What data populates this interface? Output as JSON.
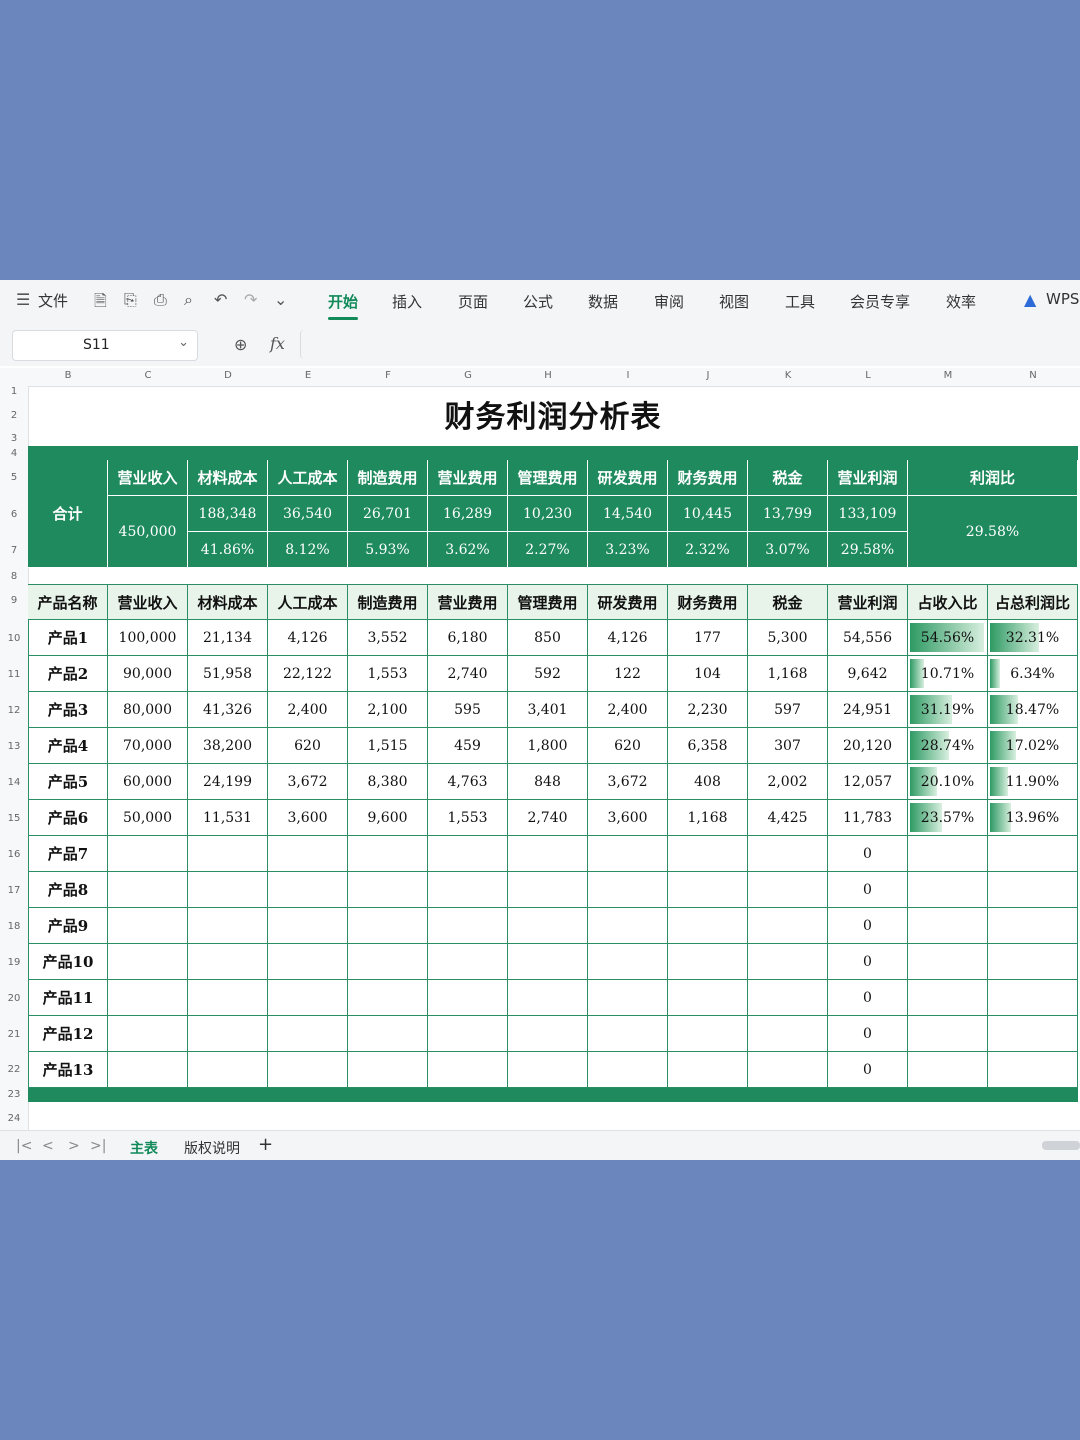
{
  "toolbar": {
    "file_label": "文件",
    "tabs": [
      "开始",
      "插入",
      "页面",
      "公式",
      "数据",
      "审阅",
      "视图",
      "工具",
      "会员专享",
      "效率"
    ],
    "active_tab": "开始",
    "brand": "WPS"
  },
  "formula_bar": {
    "cell_ref": "S11",
    "fx_label": "fx",
    "value": ""
  },
  "columns": [
    "B",
    "C",
    "D",
    "E",
    "F",
    "G",
    "H",
    "I",
    "J",
    "K",
    "L",
    "M",
    "N"
  ],
  "rows": [
    "1",
    "2",
    "3",
    "4",
    "5",
    "6",
    "7",
    "8",
    "9",
    "10",
    "11",
    "12",
    "13",
    "14",
    "15",
    "16",
    "17",
    "18",
    "19",
    "20",
    "21",
    "22",
    "23",
    "24"
  ],
  "sheet": {
    "title": "财务利润分析表",
    "summary": {
      "label": "合计",
      "headers": [
        "营业收入",
        "材料成本",
        "人工成本",
        "制造费用",
        "营业费用",
        "管理费用",
        "研发费用",
        "财务费用",
        "税金",
        "营业利润",
        "利润比"
      ],
      "revenue": "450,000",
      "values": [
        "188,348",
        "36,540",
        "26,701",
        "16,289",
        "10,230",
        "14,540",
        "10,445",
        "13,799",
        "133,109"
      ],
      "ratios": [
        "41.86%",
        "8.12%",
        "5.93%",
        "3.62%",
        "2.27%",
        "3.23%",
        "2.32%",
        "3.07%",
        "29.58%"
      ],
      "profit_ratio": "29.58%"
    },
    "table": {
      "headers": [
        "产品名称",
        "营业收入",
        "材料成本",
        "人工成本",
        "制造费用",
        "营业费用",
        "管理费用",
        "研发费用",
        "财务费用",
        "税金",
        "营业利润",
        "占收入比",
        "占总利润比"
      ],
      "rows": [
        {
          "name": "产品1",
          "cells": [
            "100,000",
            "21,134",
            "4,126",
            "3,552",
            "6,180",
            "850",
            "4,126",
            "177",
            "5,300",
            "54,556"
          ],
          "rev_pct": "54.56%",
          "rev_frac": 0.5456,
          "profit_pct": "32.31%",
          "profit_frac": 0.3231
        },
        {
          "name": "产品2",
          "cells": [
            "90,000",
            "51,958",
            "22,122",
            "1,553",
            "2,740",
            "592",
            "122",
            "104",
            "1,168",
            "9,642"
          ],
          "rev_pct": "10.71%",
          "rev_frac": 0.1071,
          "profit_pct": "6.34%",
          "profit_frac": 0.0634
        },
        {
          "name": "产品3",
          "cells": [
            "80,000",
            "41,326",
            "2,400",
            "2,100",
            "595",
            "3,401",
            "2,400",
            "2,230",
            "597",
            "24,951"
          ],
          "rev_pct": "31.19%",
          "rev_frac": 0.3119,
          "profit_pct": "18.47%",
          "profit_frac": 0.1847
        },
        {
          "name": "产品4",
          "cells": [
            "70,000",
            "38,200",
            "620",
            "1,515",
            "459",
            "1,800",
            "620",
            "6,358",
            "307",
            "20,120"
          ],
          "rev_pct": "28.74%",
          "rev_frac": 0.2874,
          "profit_pct": "17.02%",
          "profit_frac": 0.1702
        },
        {
          "name": "产品5",
          "cells": [
            "60,000",
            "24,199",
            "3,672",
            "8,380",
            "4,763",
            "848",
            "3,672",
            "408",
            "2,002",
            "12,057"
          ],
          "rev_pct": "20.10%",
          "rev_frac": 0.201,
          "profit_pct": "11.90%",
          "profit_frac": 0.119
        },
        {
          "name": "产品6",
          "cells": [
            "50,000",
            "11,531",
            "3,600",
            "9,600",
            "1,553",
            "2,740",
            "3,600",
            "1,168",
            "4,425",
            "11,783"
          ],
          "rev_pct": "23.57%",
          "rev_frac": 0.2357,
          "profit_pct": "13.96%",
          "profit_frac": 0.1396
        },
        {
          "name": "产品7",
          "cells": [
            "",
            "",
            "",
            "",
            "",
            "",
            "",
            "",
            "",
            "0"
          ],
          "rev_pct": "",
          "rev_frac": 0,
          "profit_pct": "",
          "profit_frac": 0
        },
        {
          "name": "产品8",
          "cells": [
            "",
            "",
            "",
            "",
            "",
            "",
            "",
            "",
            "",
            "0"
          ],
          "rev_pct": "",
          "rev_frac": 0,
          "profit_pct": "",
          "profit_frac": 0
        },
        {
          "name": "产品9",
          "cells": [
            "",
            "",
            "",
            "",
            "",
            "",
            "",
            "",
            "",
            "0"
          ],
          "rev_pct": "",
          "rev_frac": 0,
          "profit_pct": "",
          "profit_frac": 0
        },
        {
          "name": "产品10",
          "cells": [
            "",
            "",
            "",
            "",
            "",
            "",
            "",
            "",
            "",
            "0"
          ],
          "rev_pct": "",
          "rev_frac": 0,
          "profit_pct": "",
          "profit_frac": 0
        },
        {
          "name": "产品11",
          "cells": [
            "",
            "",
            "",
            "",
            "",
            "",
            "",
            "",
            "",
            "0"
          ],
          "rev_pct": "",
          "rev_frac": 0,
          "profit_pct": "",
          "profit_frac": 0
        },
        {
          "name": "产品12",
          "cells": [
            "",
            "",
            "",
            "",
            "",
            "",
            "",
            "",
            "",
            "0"
          ],
          "rev_pct": "",
          "rev_frac": 0,
          "profit_pct": "",
          "profit_frac": 0
        },
        {
          "name": "产品13",
          "cells": [
            "",
            "",
            "",
            "",
            "",
            "",
            "",
            "",
            "",
            "0"
          ],
          "rev_pct": "",
          "rev_frac": 0,
          "profit_pct": "",
          "profit_frac": 0
        }
      ]
    }
  },
  "sheet_tabs": {
    "items": [
      "主表",
      "版权说明"
    ],
    "active": "主表",
    "add_label": "+"
  },
  "colors": {
    "accent": "#1e8a5e",
    "header_fill": "#e8f3ea",
    "background": "#6a86bd"
  }
}
